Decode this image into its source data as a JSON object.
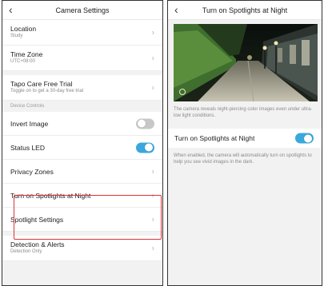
{
  "left": {
    "title": "Camera Settings",
    "rows": {
      "location": {
        "label": "Location",
        "sub": "Study"
      },
      "timezone": {
        "label": "Time Zone",
        "sub": "UTC+08:00"
      },
      "tapo": {
        "label": "Tapo Care Free Trial",
        "sub": "Toggle on to get a 30-day free trial"
      },
      "invert": {
        "label": "Invert Image",
        "on": false
      },
      "status_led": {
        "label": "Status LED",
        "on": true
      },
      "privacy": {
        "label": "Privacy Zones"
      },
      "spotlights": {
        "label": "Turn on Spotlights at Night"
      },
      "spotlight_settings": {
        "label": "Spotlight Settings"
      },
      "detection": {
        "label": "Detection & Alerts",
        "sub": "Detection Only"
      }
    },
    "section_header": "Device Controls"
  },
  "right": {
    "title": "Turn on Spotlights at Night",
    "description_top": "The camera reveals night-piercing color images even under ultra-low light conditions.",
    "toggle_label": "Turn on Spotlights at Night",
    "toggle_on": true,
    "description_bottom": "When enabled, the camera will automatically turn on spotlights to help you see vivid images in the dark."
  },
  "colors": {
    "accent": "#3aa8dc",
    "toggle_off": "#c7c7c7",
    "highlight": "#dd3333"
  },
  "icons": {
    "back": "chevron-left-icon",
    "row_arrow": "chevron-right-icon",
    "bulb": "bulb-icon"
  }
}
